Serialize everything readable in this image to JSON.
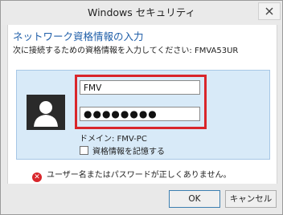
{
  "window": {
    "title": "Windows セキュリティ"
  },
  "dialog": {
    "heading": "ネットワーク資格情報の入力",
    "subtext": "次に接続するための資格情報を入力してください: FMVA53UR"
  },
  "credentials": {
    "username": "FMV",
    "password_mask": "●●●●●●●●",
    "domain": "ドメイン: FMV-PC",
    "remember_label": "資格情報を記憶する",
    "remember_checked": false
  },
  "error": {
    "message": "ユーザー名またはパスワードが正しくありません。"
  },
  "buttons": {
    "ok": "OK",
    "cancel": "キャンセル"
  },
  "colors": {
    "heading": "#1f5ea8",
    "panel": "#d8eaf8",
    "highlight_frame": "#d9262b",
    "error_icon": "#d9262b"
  }
}
